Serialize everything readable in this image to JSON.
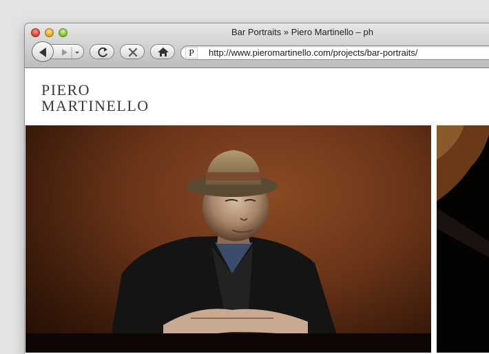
{
  "window": {
    "title": "Bar Portraits » Piero Martinello – ph"
  },
  "toolbar": {
    "back_icon": "back-arrow-icon",
    "forward_icon": "forward-arrow-icon",
    "reload_icon": "reload-icon",
    "stop_icon": "stop-icon",
    "home_icon": "home-icon"
  },
  "address_bar": {
    "favicon_letter": "P",
    "url": "http://www.pieromartinello.com/projects/bar-portraits/"
  },
  "site": {
    "logo_line1": "PIERO",
    "logo_line2": "MARTINELLO"
  },
  "gallery": {
    "main_photo": "portrait of elderly man in hat at bar table",
    "side_photo": "dark bar interior portrait"
  }
}
